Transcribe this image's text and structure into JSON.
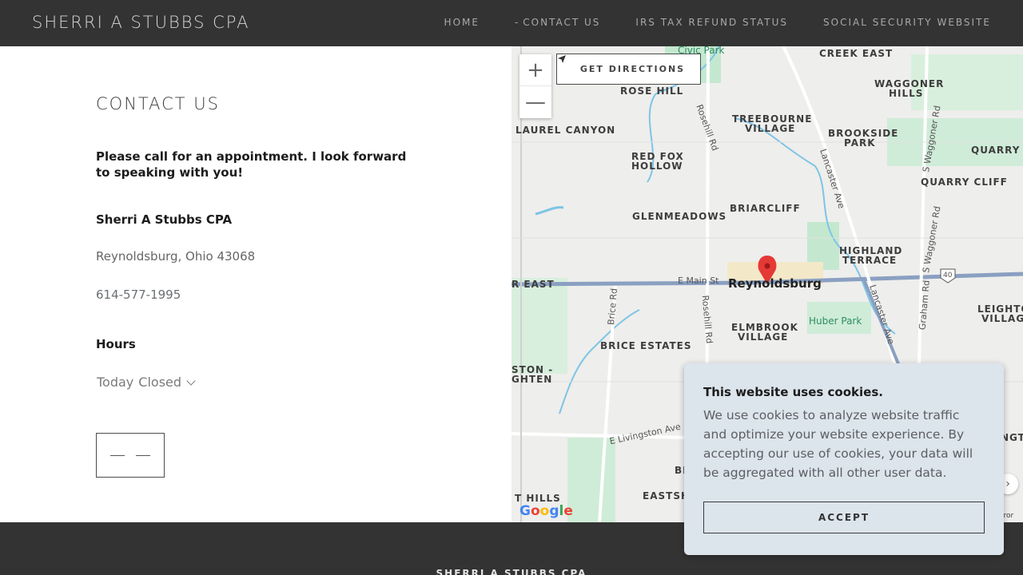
{
  "header": {
    "brand": "SHERRI A STUBBS CPA",
    "nav": [
      {
        "label": "HOME"
      },
      {
        "label": "CONTACT US"
      },
      {
        "label": "IRS TAX REFUND STATUS"
      },
      {
        "label": "SOCIAL SECURITY WEBSITE"
      }
    ]
  },
  "contact": {
    "title": "CONTACT US",
    "blurb": "Please call for an appointment. I look forward to speaking with you!",
    "business_name": "Sherri A Stubbs CPA",
    "address": "Reynoldsburg, Ohio 43068",
    "phone": "614-577-1995",
    "hours_label": "Hours",
    "hours_day": "Today",
    "hours_status": "Closed"
  },
  "map": {
    "zoom_in": "+",
    "zoom_out": "—",
    "directions_label": "GET DIRECTIONS",
    "google_logo": "Google",
    "error_text": "rror",
    "labels": {
      "civic_park": "Civic Park",
      "creek_east": "CREEK EAST",
      "rose_hill": "ROSE HILL",
      "waggoner_hills_1": "WAGGONER",
      "waggoner_hills_2": "HILLS",
      "laurel_canyon": "LAUREL CANYON",
      "treebourne_1": "TREEBOURNE",
      "treebourne_2": "VILLAGE",
      "brookside_1": "BROOKSIDE",
      "brookside_2": "PARK",
      "quarry_pa": "QUARRY PA",
      "red_fox_1": "RED FOX",
      "red_fox_2": "HOLLOW",
      "quarry_cliff": "QUARRY CLIFF",
      "glenmeadows": "GLENMEADOWS",
      "briarcliff": "BRIARCLIFF",
      "highland_1": "HIGHLAND",
      "highland_2": "TERRACE",
      "r_east": "R EAST",
      "e_main_st": "E Main St",
      "reynoldsburg": "Reynoldsburg",
      "leighto_1": "LEIGHTO",
      "leighto_2": "VILLAG",
      "elmbrook_1": "ELMBROOK",
      "elmbrook_2": "VILLAGE",
      "huber_park": "Huber Park",
      "brice_estates": "BRICE ESTATES",
      "ston_1": "STON -",
      "ston_2": "GHTEN",
      "e_livingston": "E Livingston Ave",
      "t_hills": "T HILLS",
      "eastsh": "EASTSH",
      "bl": "BL",
      "ngt": "NGT",
      "rosehill_rd": "Rosehill Rd",
      "rosehill_rd2": "Rosehill Rd",
      "lancaster_ave": "Lancaster Ave",
      "lancaster_ave2": "Lancaster Ave",
      "s_waggoner_rd": "S Waggoner Rd",
      "s_waggoner_rd2": "S Waggoner Rd",
      "brice_rd": "Brice Rd",
      "graham_rd": "Graham Rd",
      "route_40": "40"
    }
  },
  "cookie": {
    "title": "This website uses cookies.",
    "text": "We use cookies to analyze website traffic and optimize your website experience. By accepting our use of cookies, your data will be aggregated with all other user data.",
    "accept_label": "ACCEPT"
  },
  "footer": {
    "name": "SHERRI A STUBBS CPA"
  },
  "colors": {
    "header_bg": "#333333",
    "cookie_bg": "#dce4ec",
    "map_bg": "#eeeeec",
    "map_road": "#8aa0c2",
    "map_water": "#7ec4e6",
    "map_park": "#c3e8cf",
    "pin": "#e53935"
  }
}
